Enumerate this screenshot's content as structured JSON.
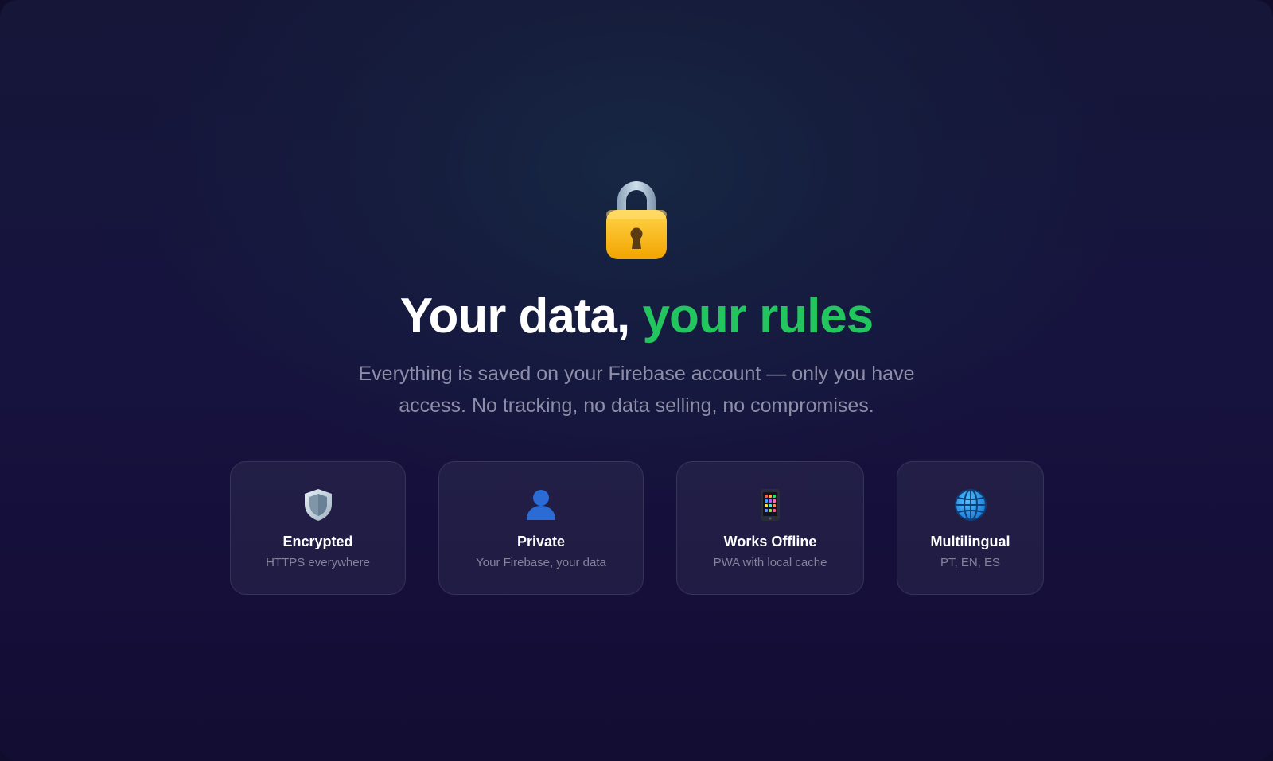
{
  "hero": {
    "icon": "lock-icon",
    "headline_main": "Your data, ",
    "headline_accent": "your rules",
    "subtitle": "Everything is saved on your Firebase account — only you have access. No tracking, no data selling, no compromises."
  },
  "features": [
    {
      "icon": "shield-icon",
      "title": "Encrypted",
      "description": "HTTPS everywhere"
    },
    {
      "icon": "user-icon",
      "title": "Private",
      "description": "Your Firebase, your data"
    },
    {
      "icon": "smartphone-icon",
      "title": "Works Offline",
      "description": "PWA with local cache"
    },
    {
      "icon": "globe-icon",
      "title": "Multilingual",
      "description": "PT, EN, ES"
    }
  ],
  "colors": {
    "background": "#151638",
    "accent": "#22c55e",
    "heading": "#ffffff",
    "muted_text": "#8f8ea8"
  }
}
